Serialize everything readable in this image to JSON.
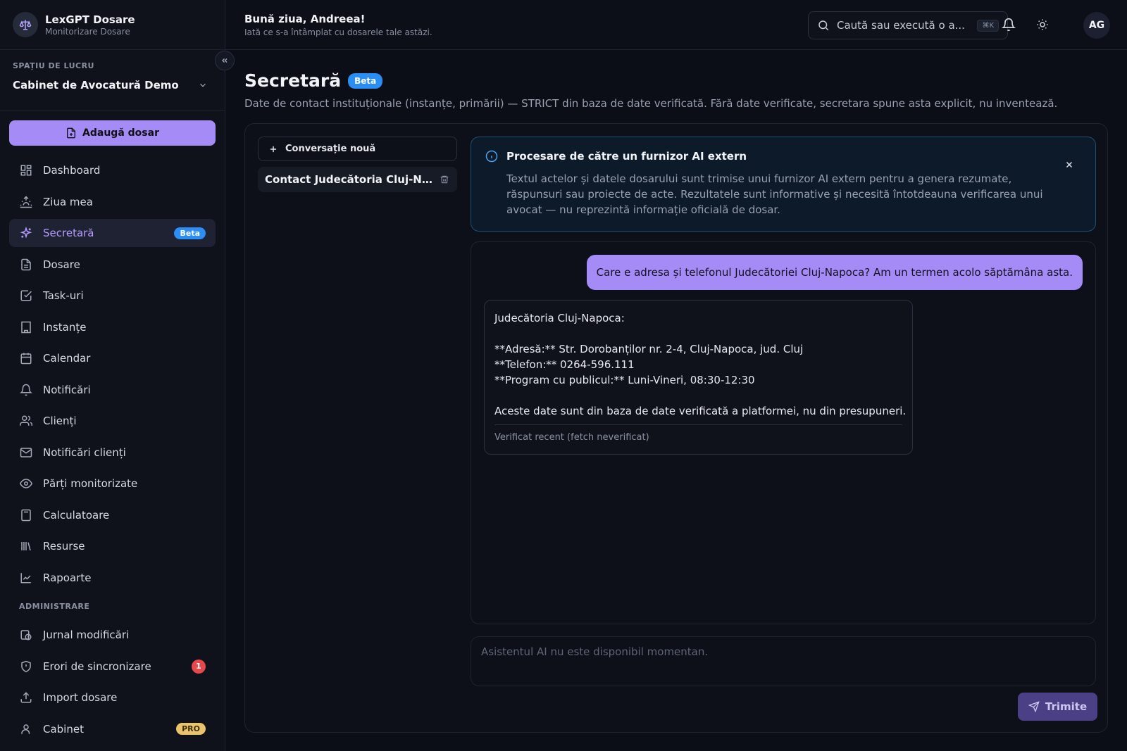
{
  "brand": {
    "title": "LexGPT Dosare",
    "subtitle": "Monitorizare Dosare",
    "logo_icon": "scale-icon"
  },
  "workspace": {
    "label": "SPAȚIU DE LUCRU",
    "name": "Cabinet de Avocatură Demo"
  },
  "add_button": "Adaugă dosar",
  "nav": {
    "items": [
      {
        "label": "Dashboard",
        "icon": "grid-icon"
      },
      {
        "label": "Ziua mea",
        "icon": "sunrise-icon"
      },
      {
        "label": "Secretară",
        "icon": "sparkles-icon",
        "badge": "Beta",
        "active": true
      },
      {
        "label": "Dosare",
        "icon": "file-icon"
      },
      {
        "label": "Task-uri",
        "icon": "check-square-icon"
      },
      {
        "label": "Instanțe",
        "icon": "building-icon"
      },
      {
        "label": "Calendar",
        "icon": "calendar-icon"
      },
      {
        "label": "Notificări",
        "icon": "bell-icon"
      },
      {
        "label": "Clienți",
        "icon": "users-icon"
      },
      {
        "label": "Notificări clienți",
        "icon": "mail-icon"
      },
      {
        "label": "Părți monitorizate",
        "icon": "eye-icon"
      },
      {
        "label": "Calculatoare",
        "icon": "calculator-icon"
      },
      {
        "label": "Resurse",
        "icon": "library-icon"
      },
      {
        "label": "Rapoarte",
        "icon": "chart-icon"
      }
    ],
    "admin_label": "ADMINISTRARE",
    "admin_items": [
      {
        "label": "Jurnal modificări",
        "icon": "history-icon"
      },
      {
        "label": "Erori de sincronizare",
        "icon": "shield-icon",
        "badge": "1"
      },
      {
        "label": "Import dosare",
        "icon": "upload-icon"
      },
      {
        "label": "Cabinet",
        "icon": "user-icon",
        "badge": "PRO"
      }
    ]
  },
  "header": {
    "greeting": "Bună ziua, Andreea!",
    "subtitle": "Iată ce s-a întâmplat cu dosarele tale astăzi.",
    "search_placeholder": "Caută sau execută o a...",
    "search_shortcut": "⌘K",
    "avatar_initials": "AG"
  },
  "page": {
    "title": "Secretară",
    "badge": "Beta",
    "description": "Date de contact instituționale (instanțe, primării) — STRICT din baza de date verificată. Fără date verificate, secretara spune asta explicit, nu inventează."
  },
  "conversations": {
    "new_label": "Conversație nouă",
    "items": [
      "Contact Judecătoria Cluj-Napoca"
    ]
  },
  "notice": {
    "title": "Procesare de către un furnizor AI extern",
    "body": "Textul actelor și datele dosarului sunt trimise unui furnizor AI extern pentru a genera rezumate, răspunsuri sau proiecte de acte. Rezultatele sunt informative și necesită întotdeauna verificarea unui avocat — nu reprezintă informație oficială de dosar."
  },
  "chat": {
    "user_message": "Care e adresa și telefonul Judecătoriei Cluj-Napoca? Am un termen acolo săptămâna asta.",
    "ai_lines": [
      "Judecătoria Cluj-Napoca:",
      "",
      "**Adresă:** Str. Dorobanților nr. 2-4, Cluj-Napoca, jud. Cluj",
      "**Telefon:** 0264-596.111",
      "**Program cu publicul:** Luni-Vineri, 08:30-12:30",
      "",
      "Aceste date sunt din baza de date verificată a platformei, nu din presupuneri."
    ],
    "ai_footer": "Verificat recent (fetch neverificat)",
    "composer_placeholder": "Asistentul AI nu este disponibil momentan.",
    "send_label": "Trimite"
  },
  "colors": {
    "accent": "#a58bf6",
    "beta_badge": "#2a8ef5",
    "error_badge": "#e5484d",
    "pro_badge": "#e9c46a",
    "background": "#0b0e17"
  }
}
